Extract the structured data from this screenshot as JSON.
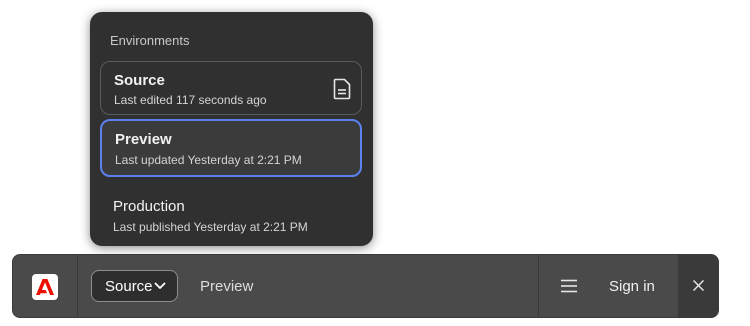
{
  "popover": {
    "heading": "Environments",
    "items": [
      {
        "title": "Source",
        "subtitle": "Last edited 117 seconds ago",
        "icon": "document-icon"
      },
      {
        "title": "Preview",
        "subtitle": "Last updated Yesterday at 2:21 PM",
        "selected": true
      },
      {
        "title": "Production",
        "subtitle": "Last published Yesterday at 2:21 PM"
      }
    ]
  },
  "toolbar": {
    "logo": "adobe-logo",
    "environment_select": "Source",
    "preview_label": "Preview",
    "menu_icon": "hamburger-menu-icon",
    "signin_label": "Sign in",
    "close_icon": "close-icon"
  },
  "colors": {
    "panel_bg": "#303030",
    "toolbar_bg": "#4a4a4a",
    "selection_border": "#5b80f0",
    "logo_red": "#eb1000"
  }
}
